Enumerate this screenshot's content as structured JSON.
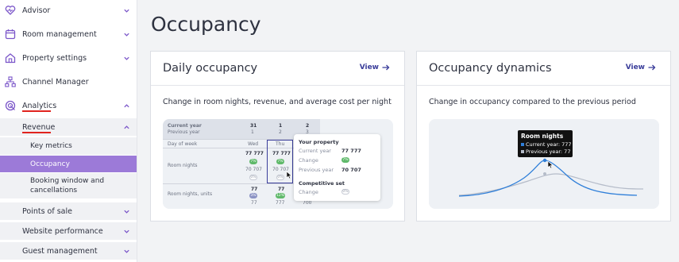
{
  "sidebar": {
    "items": [
      {
        "label": "Advisor",
        "icon": "heart-pulse-icon"
      },
      {
        "label": "Room management",
        "icon": "calendar-icon"
      },
      {
        "label": "Property settings",
        "icon": "house-icon"
      },
      {
        "label": "Channel Manager",
        "icon": "hierarchy-icon"
      },
      {
        "label": "Analytics",
        "icon": "analytics-target-icon"
      }
    ],
    "analytics_sub": {
      "label": "Revenue"
    },
    "revenue_sub": [
      {
        "label": "Key metrics"
      },
      {
        "label": "Occupancy"
      },
      {
        "label": "Booking window and cancellations"
      }
    ],
    "more": [
      {
        "label": "Points of sale"
      },
      {
        "label": "Website performance"
      },
      {
        "label": "Guest management"
      }
    ]
  },
  "page": {
    "title": "Occupancy"
  },
  "cards": [
    {
      "title": "Daily occupancy",
      "view": "View",
      "description": "Change in room nights, revenue, and average cost per night",
      "preview": {
        "header_left": "Current year",
        "header_left_sub": "Previous year",
        "cols": [
          {
            "top": "31",
            "bottom": "1"
          },
          {
            "top": "1",
            "bottom": "2"
          },
          {
            "top": "2",
            "bottom": "3"
          }
        ],
        "day_label": "Day of week",
        "days": [
          "Wed",
          "Thu"
        ],
        "row1_label": "Room nights",
        "row2_label": "Room nights, units",
        "cells": {
          "c1_cur": "77 777",
          "c1_pill": "7%",
          "c1_prev": "70 707",
          "c1_empty": "0%",
          "c2_cur": "77 777",
          "c2_pill": "7%",
          "c2_prev": "70 707",
          "c2_empty": "0%",
          "r2_c1_cur": "77",
          "r2_c1_pill": "3%",
          "r2_c1_prev": "77",
          "r2_c2_cur": "77",
          "r2_c2_pill": "12%",
          "r2_c2_prev": "777",
          "r2_c3_prev": "700"
        },
        "tooltip": {
          "heading": "Your property",
          "cur_label": "Current year",
          "cur_value": "77 777",
          "change_label": "Change",
          "change_value": "7%",
          "prev_label": "Previous year",
          "prev_value": "70 707",
          "comp_heading": "Competitive set",
          "comp_change_label": "Change",
          "comp_change_value": "0%"
        }
      }
    },
    {
      "title": "Occupancy dynamics",
      "view": "View",
      "description": "Change in occupancy compared to the previous period",
      "preview": {
        "tooltip_title": "Room nights",
        "tooltip_cur": "Current year: 777",
        "tooltip_prev": "Previous year: 77"
      }
    }
  ],
  "colors": {
    "accent": "#9c7ad8",
    "underline": "#e0241f",
    "link": "#3a3d9a",
    "line_current": "#2f7fd9",
    "line_previous": "#b5bcc9"
  }
}
